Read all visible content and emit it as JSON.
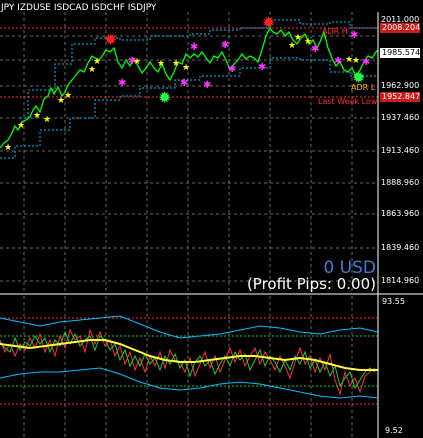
{
  "chart": {
    "title": "JPY IZDUSE ISDCAD ISDCHF ISDJPY",
    "price_labels": [
      "2011.000",
      "1985.574",
      "1962.900",
      "1937.460",
      "1913.460",
      "1888.960",
      "1863.960",
      "1839.460",
      "1814.960"
    ],
    "adr_high_badge": "2008.204",
    "current_price": "1985.574",
    "last_week_low_badge": "1952.847",
    "profit_value": "0 USD",
    "profit_pips": "(Profit Pips: 0.00)",
    "adr_high_label": "ADR H",
    "adr_low_label": "ADR L",
    "last_week_low_label": "Last Week Low",
    "indicator_max": "93.55",
    "indicator_min": "9.52"
  },
  "colors": {
    "background": "#000000",
    "price_line": "#00ff00",
    "envelope": "#00bfff",
    "star_buy": "#ffff00",
    "star_sell": "#ff33ff",
    "level_line": "#ff3030",
    "grid": "#6a6a6a"
  }
}
